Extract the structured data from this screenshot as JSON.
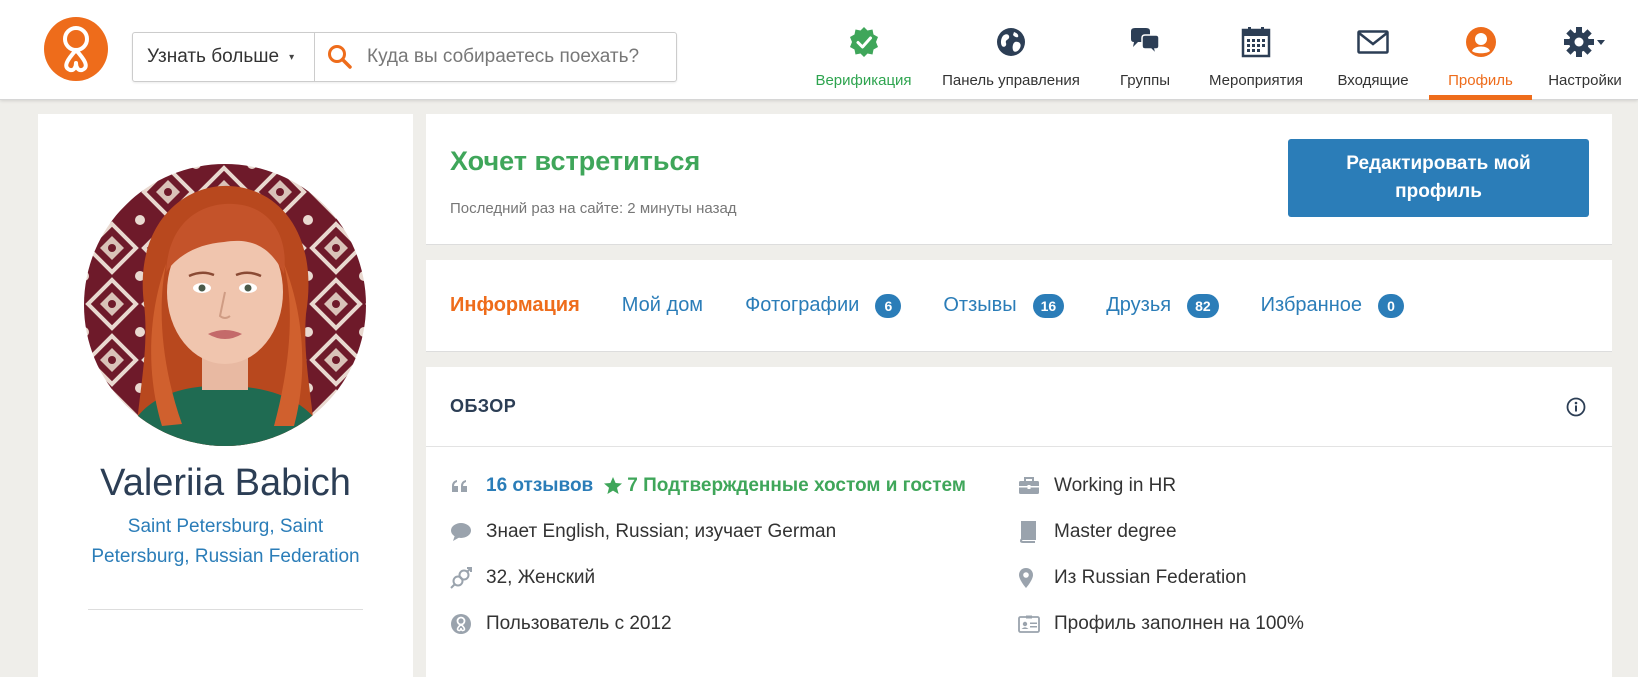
{
  "search": {
    "category_label": "Узнать больше",
    "placeholder": "Куда вы собираетесь поехать?"
  },
  "nav": {
    "verification": "Верификация",
    "dashboard": "Панель управления",
    "groups": "Группы",
    "events": "Мероприятия",
    "inbox": "Входящие",
    "profile": "Профиль",
    "settings": "Настройки"
  },
  "profile": {
    "name": "Valeriia Babich",
    "location": "Saint Petersburg, Saint Petersburg, Russian Federation"
  },
  "status": {
    "title": "Хочет встретиться",
    "last_seen": "Последний раз на сайте: 2 минуты назад",
    "edit_button": "Редактировать мой профиль"
  },
  "tabs": [
    {
      "label": "Информация",
      "active": true
    },
    {
      "label": "Мой дом"
    },
    {
      "label": "Фотографии",
      "count": "6"
    },
    {
      "label": "Отзывы",
      "count": "16"
    },
    {
      "label": "Друзья",
      "count": "82"
    },
    {
      "label": "Избранное",
      "count": "0"
    }
  ],
  "overview": {
    "title": "ОБЗОР",
    "reviews": "16 отзывов",
    "confirmed": "7 Подтвержденные хостом и гостем",
    "languages": "Знает English, Russian; изучает German",
    "age_gender": "32, Женский",
    "member_since": "Пользователь с 2012",
    "occupation": "Working in HR",
    "education": "Master degree",
    "from": "Из Russian Federation",
    "profile_complete": "Профиль заполнен на 100%"
  },
  "colors": {
    "brand_orange": "#ee6c1b",
    "link_blue": "#2b7db8",
    "green": "#3fa65a"
  }
}
